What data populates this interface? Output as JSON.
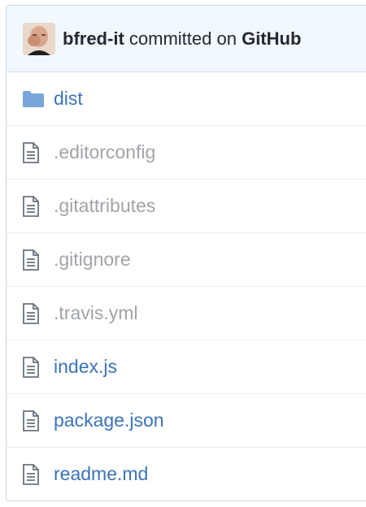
{
  "commit": {
    "author": "bfred-it",
    "action": "committed on",
    "platform": "GitHub"
  },
  "files": [
    {
      "name": "dist",
      "type": "folder",
      "style": "link",
      "icon": "folder-icon"
    },
    {
      "name": ".editorconfig",
      "type": "file",
      "style": "dim",
      "icon": "file-icon"
    },
    {
      "name": ".gitattributes",
      "type": "file",
      "style": "dim",
      "icon": "file-icon"
    },
    {
      "name": ".gitignore",
      "type": "file",
      "style": "dim",
      "icon": "file-icon"
    },
    {
      "name": ".travis.yml",
      "type": "file",
      "style": "dim",
      "icon": "file-icon"
    },
    {
      "name": "index.js",
      "type": "file",
      "style": "link",
      "icon": "file-icon"
    },
    {
      "name": "package.json",
      "type": "file",
      "style": "link",
      "icon": "file-icon"
    },
    {
      "name": "readme.md",
      "type": "file",
      "style": "link",
      "icon": "file-icon"
    }
  ],
  "colors": {
    "header_bg": "#f1f8ff",
    "link": "#3b73b9",
    "dim": "#a0a4a8",
    "folder": "#79b8ff"
  }
}
